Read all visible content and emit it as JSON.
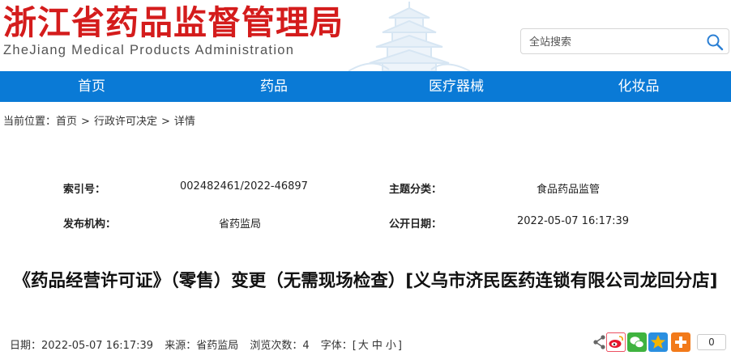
{
  "header": {
    "logo_cn": "浙江省药品监督管理局",
    "logo_en": "ZheJiang Medical Products Administration",
    "search_placeholder": "全站搜索"
  },
  "nav": {
    "items": [
      {
        "label": "首页"
      },
      {
        "label": "药品"
      },
      {
        "label": "医疗器械"
      },
      {
        "label": "化妆品"
      }
    ]
  },
  "breadcrumb": {
    "prefix": "当前位置：",
    "home": "首页",
    "sep": ">",
    "category": "行政许可决定",
    "current": "详情"
  },
  "meta": {
    "index_label": "索引号：",
    "index_value": "002482461/2022-46897",
    "topic_label": "主题分类：",
    "topic_value": "食品药品监管",
    "publisher_label": "发布机构：",
    "publisher_value": "省药监局",
    "date_label": "公开日期：",
    "date_value": "2022-05-07 16:17:39"
  },
  "article": {
    "title": "《药品经营许可证》（零售）变更（无需现场检查）[义乌市济民医药连锁有限公司龙回分店]"
  },
  "info": {
    "date": "日期：2022-05-07 16:17:39",
    "source": "来源：省药监局",
    "views": "浏览次数：4",
    "font_prefix": "字体：[",
    "font_large": "大",
    "font_medium": "中",
    "font_small": "小",
    "font_suffix": "]"
  },
  "share": {
    "count": "0",
    "colors": {
      "weibo": "#e6162d",
      "wechat": "#3fb33f",
      "qzone": "#f5b400",
      "more": "#f27a1a"
    }
  },
  "colors": {
    "brand_red": "#d41c1c",
    "nav_blue": "#0a7ad6"
  }
}
